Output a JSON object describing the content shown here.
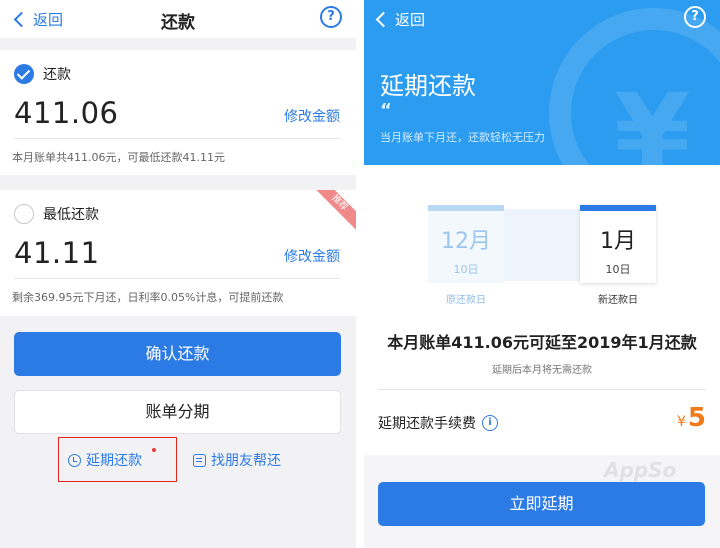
{
  "left": {
    "nav": {
      "back_label": "返回",
      "title": "还款",
      "help": "?"
    },
    "full_payment": {
      "label": "还款",
      "selected": true,
      "amount": "411.06",
      "modify_label": "修改金额",
      "note": "本月账单共411.06元，可最低还款41.11元"
    },
    "min_payment": {
      "label": "最低还款",
      "selected": false,
      "amount": "41.11",
      "modify_label": "修改金额",
      "note": "剩余369.95元下月还，日利率0.05%计息，可提前还款",
      "badge": "推荐"
    },
    "confirm_label": "确认还款",
    "installment_label": "账单分期",
    "defer_link": "延期还款",
    "friend_link": "找朋友帮还"
  },
  "right": {
    "nav": {
      "back_label": "返回",
      "help": "?"
    },
    "hero": {
      "title": "延期还款",
      "quote_mark": "“",
      "subtitle": "当月账单下月还，还款轻松无压力"
    },
    "original_date": {
      "month": "12月",
      "day": "10日",
      "label": "原还款日"
    },
    "new_date": {
      "month": "1月",
      "day": "10日",
      "label": "新还款日"
    },
    "headline": "本月账单411.06元可延至2019年1月还款",
    "subline": "延期后本月将无需还款",
    "fee_label": "延期还款手续费",
    "fee_info": "i",
    "fee_currency": "¥",
    "fee_amount": "5",
    "watermark": "AppSo",
    "defer_now_label": "立即延期"
  },
  "colors": {
    "accent": "#2c7be5",
    "hero_bg": "#2c9cf0",
    "fee": "#f07a18",
    "highlight": "#e0261f"
  }
}
